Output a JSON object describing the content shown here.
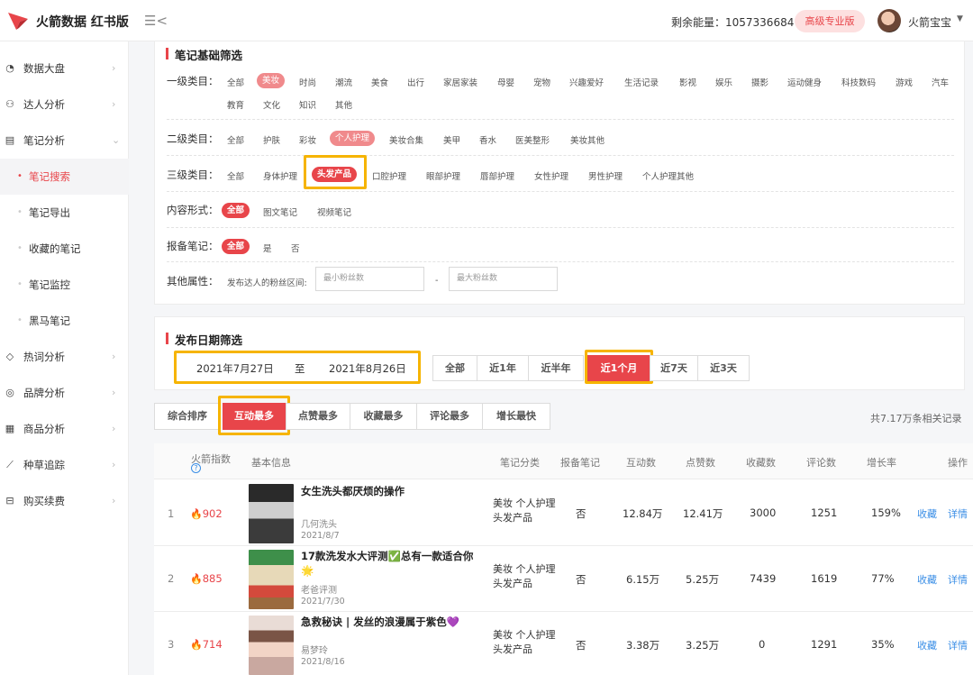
{
  "topbar": {
    "brand": "火箭数据 红书版",
    "collapse_icon": "☰<",
    "energy": "剩余能量：1057336684",
    "tier": "高级专业版",
    "username": "火箭宝宝",
    "caret": "▼"
  },
  "sidebar": {
    "items": [
      {
        "icon": "◔",
        "label": "数据大盘",
        "chev": "›"
      },
      {
        "icon": "⚇",
        "label": "达人分析",
        "chev": "›"
      },
      {
        "icon": "▤",
        "label": "笔记分析",
        "chev": "⌄"
      },
      {
        "icon": "◇",
        "label": "热词分析",
        "chev": "›"
      },
      {
        "icon": "◎",
        "label": "品牌分析",
        "chev": "›"
      },
      {
        "icon": "▦",
        "label": "商品分析",
        "chev": "›"
      },
      {
        "icon": "⟋",
        "label": "种草追踪",
        "chev": "›"
      },
      {
        "icon": "⊟",
        "label": "购买续费",
        "chev": "›"
      }
    ],
    "subitems": [
      "笔记搜索",
      "笔记导出",
      "收藏的笔记",
      "笔记监控",
      "黑马笔记"
    ],
    "bullet": "•"
  },
  "filters": {
    "title": "笔记基础筛选",
    "level1_label": "一级类目：",
    "level1_row1": [
      "全部",
      "美妆",
      "时尚",
      "潮流",
      "美食",
      "出行",
      "家居家装",
      "母婴",
      "宠物",
      "兴趣爱好",
      "生活记录",
      "影视",
      "娱乐",
      "摄影",
      "运动健身",
      "科技数码",
      "游戏",
      "汽车"
    ],
    "level1_row2": [
      "教育",
      "文化",
      "知识",
      "其他"
    ],
    "level2_label": "二级类目：",
    "level2": [
      "全部",
      "护肤",
      "彩妆",
      "个人护理",
      "美妆合集",
      "美甲",
      "香水",
      "医美整形",
      "美妆其他"
    ],
    "level3_label": "三级类目：",
    "level3": [
      "全部",
      "身体护理",
      "头发产品",
      "口腔护理",
      "眼部护理",
      "唇部护理",
      "女性护理",
      "男性护理",
      "个人护理其他"
    ],
    "format_label": "内容形式：",
    "format": [
      "全部",
      "图文笔记",
      "视频笔记"
    ],
    "report_label": "报备笔记：",
    "report": [
      "全部",
      "是",
      "否"
    ],
    "other_label": "其他属性：",
    "fans_label": "发布达人的粉丝区间:",
    "min_placeholder": "最小粉丝数",
    "range_dash": "-",
    "max_placeholder": "最大粉丝数"
  },
  "date_filter": {
    "title": "发布日期筛选",
    "start": "2021年7月27日",
    "to": "至",
    "end": "2021年8月26日",
    "quick": [
      "全部",
      "近1年",
      "近半年",
      "近1个月",
      "近7天",
      "近3天"
    ],
    "active_quick": "近1个月"
  },
  "sort": {
    "options": [
      "综合排序",
      "互动最多",
      "点赞最多",
      "收藏最多",
      "评论最多",
      "增长最快"
    ],
    "active": "互动最多",
    "total": "共7.17万条相关记录"
  },
  "table": {
    "headers": {
      "index": "火箭指数",
      "info_icon": "?",
      "basic": "基本信息",
      "category": "笔记分类",
      "report": "报备笔记",
      "interact": "互动数",
      "likes": "点赞数",
      "favs": "收藏数",
      "comments": "评论数",
      "growth": "增长率",
      "action": "操作"
    },
    "flame": "🔥",
    "rows": [
      {
        "rank": "1",
        "score": "902",
        "title": "女生洗头都厌烦的操作",
        "author": "几何洗头",
        "date": "2021/8/7",
        "category": "美妆 个人护理 头发产品",
        "report": "否",
        "interact": "12.84万",
        "likes": "12.41万",
        "favs": "3000",
        "comments": "1251",
        "growth": "159%",
        "fav_link": "收藏",
        "detail_link": "详情"
      },
      {
        "rank": "2",
        "score": "885",
        "title": "17款洗发水大评测✅总有一款适合你",
        "title2": "🌟",
        "author": "老爸评测",
        "date": "2021/7/30",
        "category": "美妆 个人护理 头发产品",
        "report": "否",
        "interact": "6.15万",
        "likes": "5.25万",
        "favs": "7439",
        "comments": "1619",
        "growth": "77%",
        "fav_link": "收藏",
        "detail_link": "详情"
      },
      {
        "rank": "3",
        "score": "714",
        "title": "急救秘诀 | 发丝的浪漫属于紫色💜",
        "author": "易梦玲",
        "date": "2021/8/16",
        "category": "美妆 个人护理 头发产品",
        "report": "否",
        "interact": "3.38万",
        "likes": "3.25万",
        "favs": "0",
        "comments": "1291",
        "growth": "35%",
        "fav_link": "收藏",
        "detail_link": "详情"
      }
    ]
  },
  "colors": {
    "accent": "#e8454a",
    "highlight": "#f6b400",
    "link": "#3a8ee6"
  }
}
